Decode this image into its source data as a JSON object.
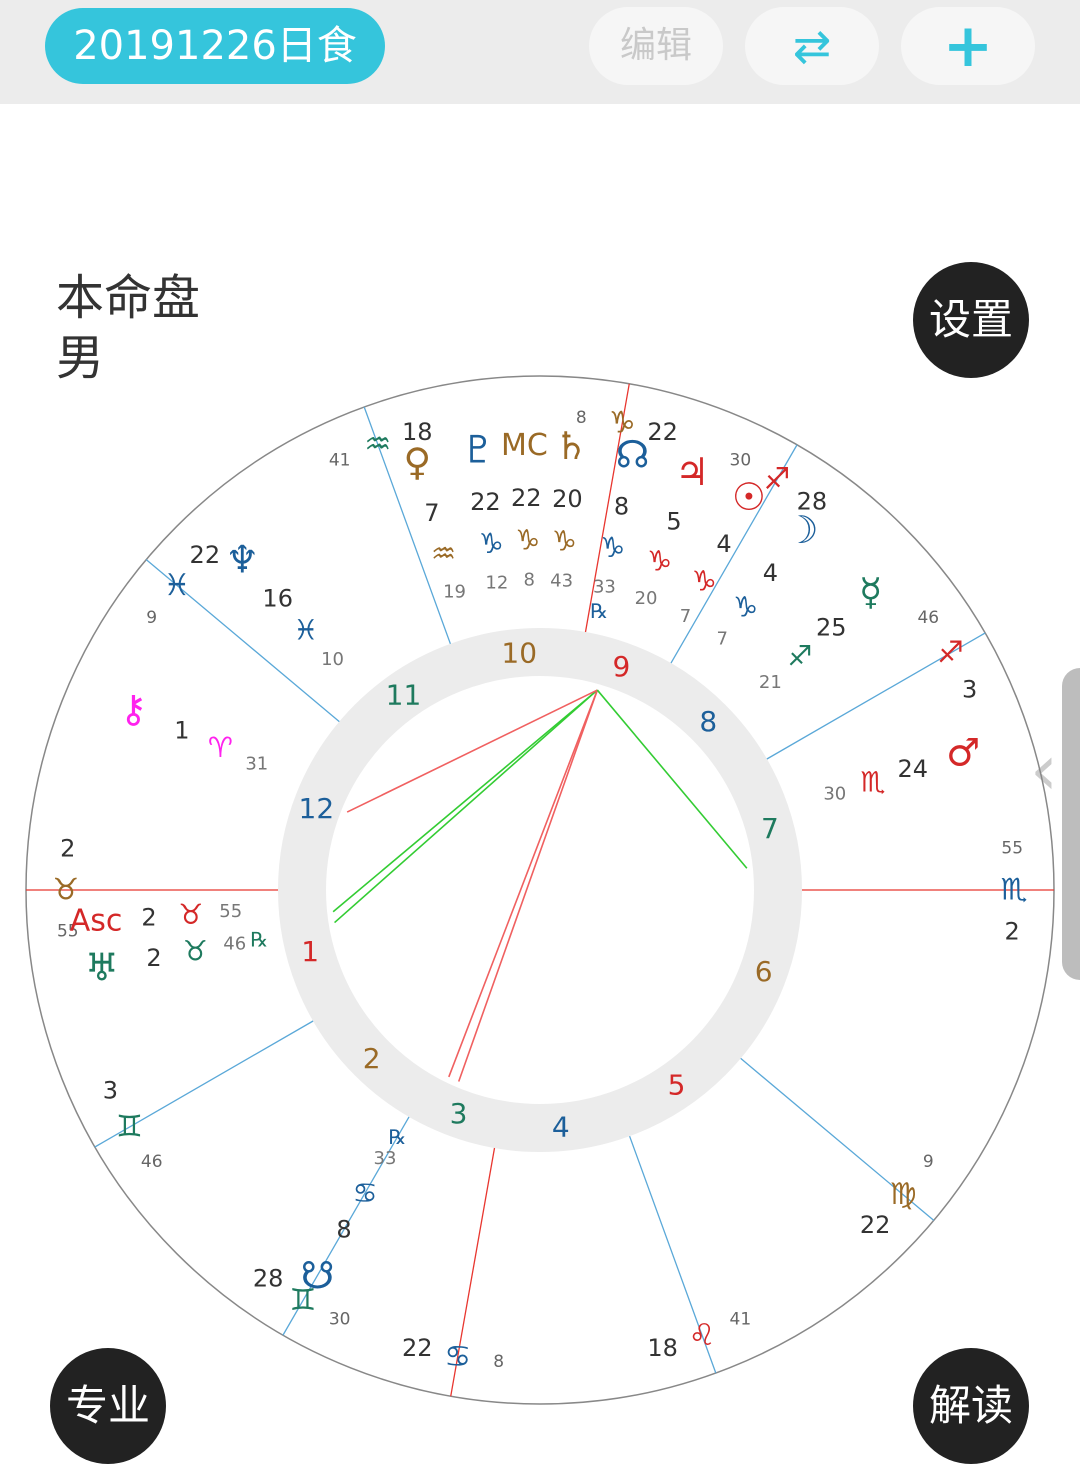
{
  "header": {
    "title": "20191226日食",
    "edit_label": "编辑",
    "swap_icon": "⇄",
    "add_icon": "+"
  },
  "chart_info": {
    "type_label": "本命盘",
    "gender_label": "男"
  },
  "buttons": {
    "settings": "设置",
    "professional": "专业",
    "interpret": "解读"
  },
  "colors": {
    "accent": "#35c5dc",
    "fire": "#d42828",
    "earth": "#9a6a26",
    "air": "#1e7a5e",
    "water": "#1c5f9a",
    "chiron": "#ff22ee",
    "house_line": "#5aa8d8",
    "angle_line": "#e8362f",
    "square_aspect": "#f06060",
    "trine_aspect": "#33cc33"
  },
  "wheel": {
    "cusp_labels": [
      {
        "deg": "2",
        "sign": "♉",
        "min": "55",
        "sign_color": "earth"
      },
      {
        "deg": "3",
        "sign": "♊",
        "min": "46",
        "sign_color": "air"
      },
      {
        "deg": "28",
        "sign": "♊",
        "min": "30",
        "sign_color": "air"
      },
      {
        "deg": "22",
        "sign": "♋",
        "min": "8",
        "sign_color": "water"
      },
      {
        "deg": "18",
        "sign": "♌",
        "min": "41",
        "sign_color": "fire"
      },
      {
        "deg": "22",
        "sign": "♍",
        "min": "9",
        "sign_color": "earth"
      },
      {
        "deg": "2",
        "sign": "♏",
        "min": "55",
        "sign_color": "water"
      },
      {
        "deg": "3",
        "sign": "♐",
        "min": "46",
        "sign_color": "fire"
      },
      {
        "deg": "28",
        "sign": "♐",
        "min": "30",
        "sign_color": "fire"
      },
      {
        "deg": "22",
        "sign": "♑",
        "min": "8",
        "sign_color": "earth"
      },
      {
        "deg": "18",
        "sign": "♒",
        "min": "41",
        "sign_color": "air"
      },
      {
        "deg": "22",
        "sign": "♓",
        "min": "9",
        "sign_color": "water"
      }
    ],
    "houses": [
      "1",
      "2",
      "3",
      "4",
      "5",
      "6",
      "7",
      "8",
      "9",
      "10",
      "11",
      "12"
    ],
    "points": [
      {
        "name": "Pluto",
        "glyph": "♇",
        "deg": "22",
        "sign": "♑",
        "min": "12",
        "rx": "",
        "color": "water"
      },
      {
        "name": "MC",
        "glyph": "MC",
        "deg": "22",
        "sign": "♑",
        "min": "8",
        "rx": "",
        "color": "earth"
      },
      {
        "name": "Saturn",
        "glyph": "♄",
        "deg": "20",
        "sign": "♑",
        "min": "43",
        "rx": "",
        "color": "earth"
      },
      {
        "name": "North Node",
        "glyph": "☊",
        "deg": "8",
        "sign": "♑",
        "min": "33",
        "rx": "℞",
        "color": "water"
      },
      {
        "name": "Jupiter",
        "glyph": "♃",
        "deg": "5",
        "sign": "♑",
        "min": "20",
        "rx": "",
        "color": "fire"
      },
      {
        "name": "Sun",
        "glyph": "☉",
        "deg": "4",
        "sign": "♑",
        "min": "7",
        "rx": "",
        "color": "fire"
      },
      {
        "name": "Moon",
        "glyph": "☽",
        "deg": "4",
        "sign": "♑",
        "min": "7",
        "rx": "",
        "color": "water"
      },
      {
        "name": "Mercury",
        "glyph": "☿",
        "deg": "25",
        "sign": "♐",
        "min": "21",
        "rx": "",
        "color": "air"
      },
      {
        "name": "Mars",
        "glyph": "♂",
        "deg": "24",
        "sign": "♏",
        "min": "30",
        "rx": "",
        "color": "fire"
      },
      {
        "name": "Venus",
        "glyph": "♀",
        "deg": "7",
        "sign": "♒",
        "min": "19",
        "rx": "",
        "color": "earth"
      },
      {
        "name": "Neptune",
        "glyph": "♆",
        "deg": "16",
        "sign": "♓",
        "min": "10",
        "rx": "",
        "color": "water"
      },
      {
        "name": "Chiron",
        "glyph": "⚷",
        "deg": "1",
        "sign": "♈",
        "min": "31",
        "rx": "",
        "color": "chiron"
      },
      {
        "name": "Uranus",
        "glyph": "♅",
        "deg": "2",
        "sign": "♉",
        "min": "46",
        "rx": "℞",
        "color": "air"
      },
      {
        "name": "Asc",
        "glyph": "Asc",
        "deg": "2",
        "sign": "♉",
        "min": "55",
        "rx": "",
        "color": "fire"
      },
      {
        "name": "South Node",
        "glyph": "☋",
        "deg": "8",
        "sign": "♋",
        "min": "33",
        "rx": "℞",
        "color": "water"
      }
    ]
  }
}
